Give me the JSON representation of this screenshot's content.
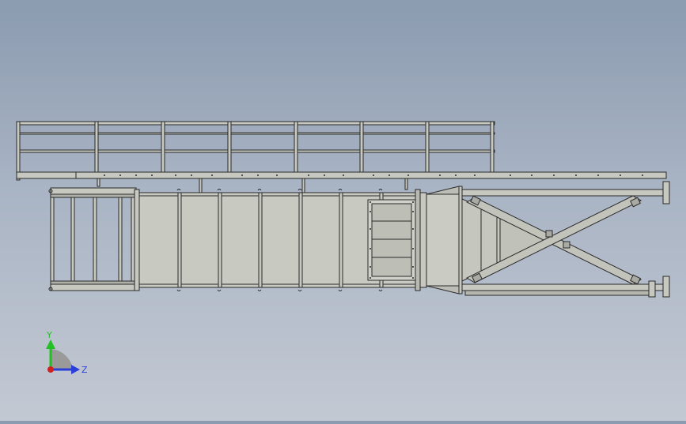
{
  "viewport": {
    "background_top": "#8b9bb0",
    "background_bottom": "#c3c9d3"
  },
  "model": {
    "line_color": "#2a2a2a",
    "fill_color": "#c7c8c0",
    "panel_fill": "#bdbeb6"
  },
  "triad": {
    "y_label": "Y",
    "z_label": "Z",
    "y_color": "#22c022",
    "z_color": "#2a3fd8",
    "x_color": "#d02020",
    "icon": "axis-triad-icon"
  }
}
